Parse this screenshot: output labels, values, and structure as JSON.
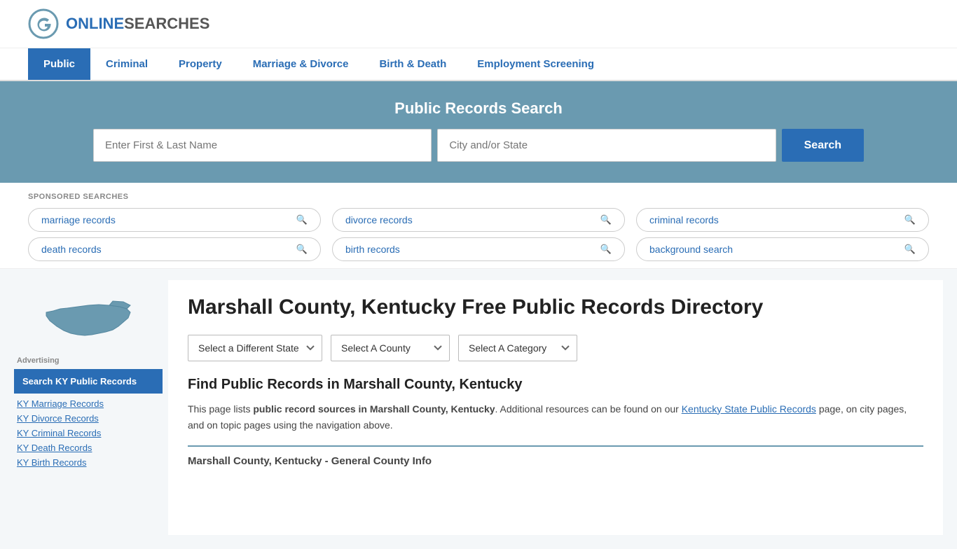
{
  "logo": {
    "text_online": "ONLINE",
    "text_searches": "SEARCHES"
  },
  "nav": {
    "items": [
      {
        "label": "Public",
        "active": true
      },
      {
        "label": "Criminal",
        "active": false
      },
      {
        "label": "Property",
        "active": false
      },
      {
        "label": "Marriage & Divorce",
        "active": false
      },
      {
        "label": "Birth & Death",
        "active": false
      },
      {
        "label": "Employment Screening",
        "active": false
      }
    ]
  },
  "search_banner": {
    "title": "Public Records Search",
    "name_placeholder": "Enter First & Last Name",
    "location_placeholder": "City and/or State",
    "button_label": "Search"
  },
  "sponsored": {
    "label": "SPONSORED SEARCHES",
    "tags": [
      "marriage records",
      "divorce records",
      "criminal records",
      "death records",
      "birth records",
      "background search"
    ]
  },
  "sidebar": {
    "ad_label": "Advertising",
    "ad_box_text": "Search KY Public Records",
    "links": [
      "KY Marriage Records",
      "KY Divorce Records",
      "KY Criminal Records",
      "KY Death Records",
      "KY Birth Records"
    ]
  },
  "directory": {
    "page_title": "Marshall County, Kentucky Free Public Records Directory",
    "dropdowns": {
      "state": "Select a Different State",
      "county": "Select A County",
      "category": "Select A Category"
    },
    "find_title": "Find Public Records in Marshall County, Kentucky",
    "find_text_1": "This page lists ",
    "find_bold": "public record sources in Marshall County, Kentucky",
    "find_text_2": ". Additional resources can be found on our ",
    "find_link": "Kentucky State Public Records",
    "find_text_3": " page, on city pages, and on topic pages using the navigation above.",
    "county_info_title": "Marshall County, Kentucky - General County Info"
  }
}
